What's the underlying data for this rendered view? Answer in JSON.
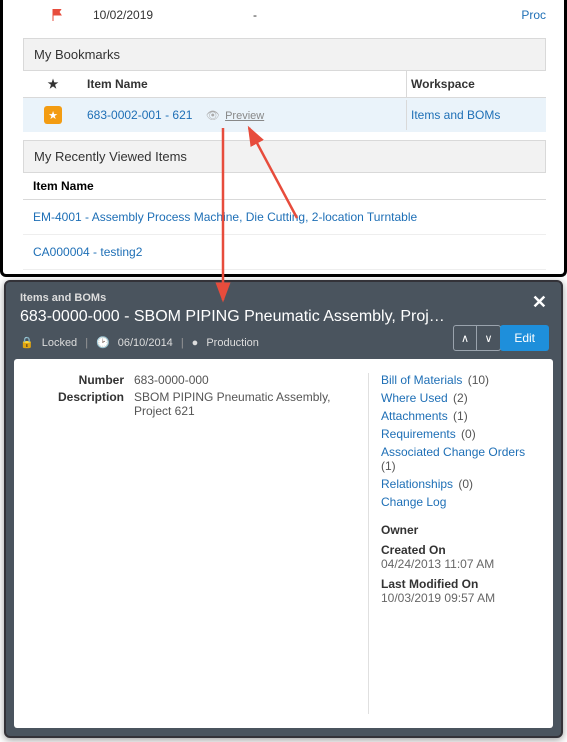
{
  "top_row": {
    "date": "10/02/2019",
    "dash": "-",
    "proc": "Proc"
  },
  "bookmarks": {
    "title": "My Bookmarks",
    "cols": [
      "Item Name",
      "Workspace"
    ],
    "row": {
      "item": "683-0002-001 - 621",
      "preview": "Preview",
      "ws": "Items and BOMs"
    }
  },
  "recent": {
    "title": "My Recently Viewed Items",
    "col": "Item Name",
    "items": [
      "EM-4001 - Assembly Process Machine, Die Cutting, 2-location Turntable",
      "CA000004 - testing2"
    ]
  },
  "panel": {
    "workspace": "Items and BOMs",
    "title": "683-0000-000 - SBOM PIPING Pneumatic Assembly, Proj…",
    "locked": "Locked",
    "date": "06/10/2014",
    "state": "Production",
    "edit": "Edit",
    "details": {
      "number_label": "Number",
      "number": "683-0000-000",
      "desc_label": "Description",
      "desc": "SBOM PIPING Pneumatic Assembly, Project 621"
    },
    "links": [
      {
        "t": "Bill of Materials",
        "c": "(10)"
      },
      {
        "t": "Where Used",
        "c": "(2)"
      },
      {
        "t": "Attachments",
        "c": "(1)"
      },
      {
        "t": "Requirements",
        "c": "(0)"
      },
      {
        "t": "Associated Change Orders",
        "c": "(1)"
      },
      {
        "t": "Relationships",
        "c": "(0)"
      },
      {
        "t": "Change Log",
        "c": ""
      }
    ],
    "owner": {
      "owner_lbl": "Owner",
      "created_lbl": "Created On",
      "created": "04/24/2013 11:07 AM",
      "modified_lbl": "Last Modified On",
      "modified": "10/03/2019 09:57 AM"
    }
  }
}
